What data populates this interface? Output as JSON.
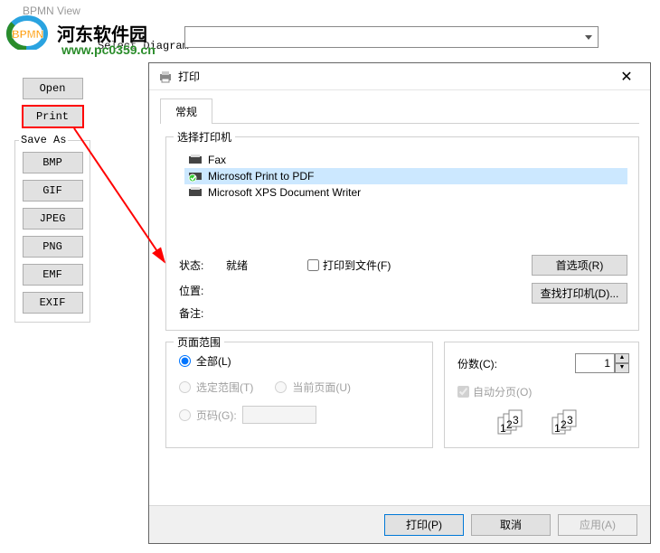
{
  "watermark": {
    "text": "河东软件园",
    "url": "www.pc0359.cn"
  },
  "app": {
    "title": "BPMN View"
  },
  "selectLabel": "Select Diagram",
  "sidebar": {
    "open": "Open",
    "print": "Print",
    "saveAsTitle": "Save As",
    "formats": [
      "BMP",
      "GIF",
      "JPEG",
      "PNG",
      "EMF",
      "EXIF"
    ]
  },
  "dialog": {
    "title": "打印",
    "tab": "常规",
    "printerGroup": "选择打印机",
    "printers": [
      {
        "name": "Fax",
        "selected": false
      },
      {
        "name": "Microsoft Print to PDF",
        "selected": true
      },
      {
        "name": "Microsoft XPS Document Writer",
        "selected": false
      }
    ],
    "statusLabel": "状态:",
    "statusValue": "就绪",
    "locationLabel": "位置:",
    "commentLabel": "备注:",
    "printToFile": "打印到文件(F)",
    "preferences": "首选项(R)",
    "findPrinter": "查找打印机(D)...",
    "rangeGroup": "页面范围",
    "rangeAll": "全部(L)",
    "rangeSelection": "选定范围(T)",
    "rangeCurrent": "当前页面(U)",
    "rangePages": "页码(G):",
    "copiesLabel": "份数(C):",
    "copiesValue": "1",
    "collate": "自动分页(O)",
    "btnPrint": "打印(P)",
    "btnCancel": "取消",
    "btnApply": "应用(A)"
  }
}
